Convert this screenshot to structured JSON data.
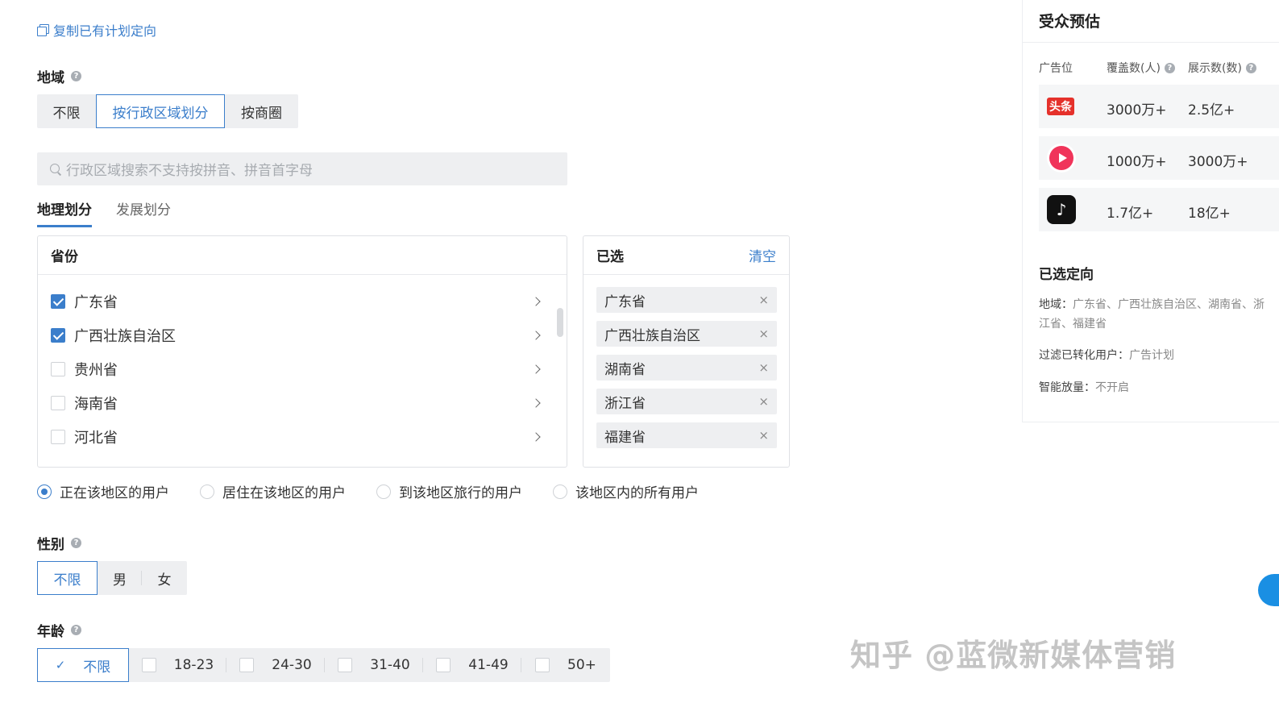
{
  "copy_link": "复制已有计划定向",
  "region": {
    "title": "地域",
    "modes": [
      "不限",
      "按行政区域划分",
      "按商圈"
    ],
    "active_mode": "按行政区域划分",
    "search_placeholder": "行政区域搜索不支持按拼音、拼音首字母",
    "tabs": [
      "地理划分",
      "发展划分"
    ],
    "active_tab": "地理划分",
    "province_header": "省份",
    "provinces": [
      {
        "name": "广东省",
        "checked": true
      },
      {
        "name": "广西壮族自治区",
        "checked": true
      },
      {
        "name": "贵州省",
        "checked": false
      },
      {
        "name": "海南省",
        "checked": false
      },
      {
        "name": "河北省",
        "checked": false
      }
    ],
    "selected_header": "已选",
    "clear_label": "清空",
    "selected": [
      "广东省",
      "广西壮族自治区",
      "湖南省",
      "浙江省",
      "福建省"
    ],
    "remove_icon": "×",
    "user_types": [
      "正在该地区的用户",
      "居住在该地区的用户",
      "到该地区旅行的用户",
      "该地区内的所有用户"
    ],
    "active_user_type": "正在该地区的用户"
  },
  "gender": {
    "title": "性别",
    "options": [
      "不限",
      "男",
      "女"
    ],
    "active": "不限"
  },
  "age": {
    "title": "年龄",
    "options": [
      "不限",
      "18-23",
      "24-30",
      "31-40",
      "41-49",
      "50+"
    ],
    "active": "不限"
  },
  "audience": {
    "title": "受众预估",
    "col_placement": "广告位",
    "col_coverage": "覆盖数(人)",
    "col_impressions": "展示数(数)",
    "rows": [
      {
        "logo": "头条",
        "icon": "toutiao-icon",
        "coverage": "3000万+",
        "impressions": "2.5亿+"
      },
      {
        "logo": "",
        "icon": "xigua-video-icon",
        "coverage": "1000万+",
        "impressions": "3000万+"
      },
      {
        "logo": "♪",
        "icon": "douyin-icon",
        "coverage": "1.7亿+",
        "impressions": "18亿+"
      }
    ],
    "selected_title": "已选定向",
    "region_label": "地域：",
    "region_value": "广东省、广西壮族自治区、湖南省、浙江省、福建省",
    "filter_label": "过滤已转化用户：",
    "filter_value": "广告计划",
    "smart_label": "智能放量：",
    "smart_value": "不开启"
  },
  "watermark": "知乎 @蓝微新媒体营销",
  "colors": {
    "accent": "#3b7ecb",
    "segment_bg": "#eeeff1",
    "toutiao_red": "#e5312b"
  }
}
